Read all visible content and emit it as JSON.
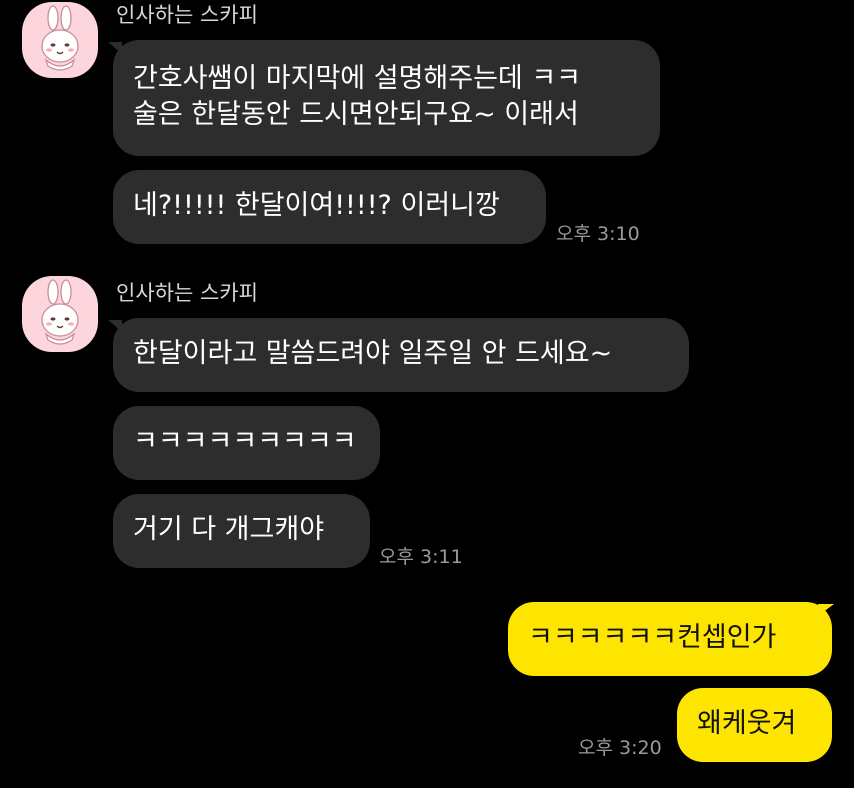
{
  "colors": {
    "background": "#000000",
    "incoming_bubble": "#2d2d2d",
    "outgoing_bubble": "#fee500",
    "sender_text": "#d8d8d8",
    "timestamp_text": "#9a9a9a",
    "avatar_background": "#fcd5dd"
  },
  "groups": [
    {
      "sender": "인사하는 스카피",
      "avatar_icon": "scrappy-rabbit-avatar-icon",
      "messages": [
        {
          "line1": "간호사쌤이 마지막에 설명해주는데 ㅋㅋ",
          "line2": "술은 한달동안 드시면안되구요~ 이래서"
        },
        {
          "text": "네?!!!!! 한달이여!!!!? 이러니깡"
        }
      ],
      "time": "오후 3:10"
    },
    {
      "sender": "인사하는 스카피",
      "avatar_icon": "scrappy-rabbit-avatar-icon",
      "messages": [
        {
          "text": "한달이라고 말씀드려야 일주일 안 드세요~"
        },
        {
          "text": "ㅋㅋㅋㅋㅋㅋㅋㅋㅋ"
        },
        {
          "text": "거기 다 개그캐야"
        }
      ],
      "time": "오후 3:11"
    }
  ],
  "outgoing": {
    "messages": [
      {
        "text": "ㅋㅋㅋㅋㅋㅋ컨셉인가"
      },
      {
        "text": "왜케웃겨"
      }
    ],
    "time": "오후 3:20"
  }
}
